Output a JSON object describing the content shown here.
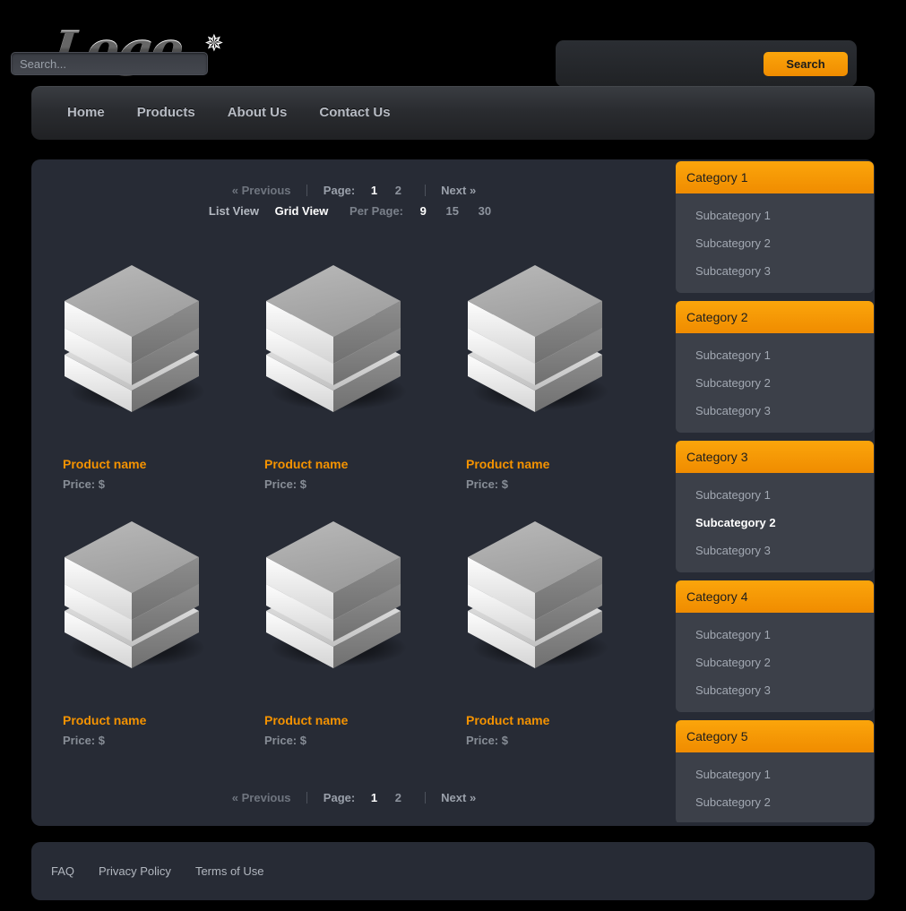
{
  "header": {
    "logo_text": "Logo",
    "logo_star_icon": "starburst-icon"
  },
  "search": {
    "placeholder": "Search...",
    "value": "",
    "button_label": "Search"
  },
  "nav": {
    "items": [
      {
        "label": "Home"
      },
      {
        "label": "Products"
      },
      {
        "label": "About Us"
      },
      {
        "label": "Contact Us"
      }
    ]
  },
  "pagination": {
    "previous_label": "« Previous",
    "page_label": "Page:",
    "pages": [
      {
        "label": "1",
        "active": true
      },
      {
        "label": "2",
        "active": false
      }
    ],
    "next_label": "Next »"
  },
  "view_options": {
    "list_view_label": "List View",
    "grid_view_label": "Grid View",
    "active_view": "Grid View",
    "per_page_label": "Per Page:",
    "per_page_options": [
      {
        "label": "9",
        "active": true
      },
      {
        "label": "15",
        "active": false
      },
      {
        "label": "30",
        "active": false
      }
    ]
  },
  "products": [
    {
      "name": "Product name",
      "price": "Price: $",
      "image_icon": "stacked-slabs-icon"
    },
    {
      "name": "Product name",
      "price": "Price: $",
      "image_icon": "stacked-slabs-icon"
    },
    {
      "name": "Product name",
      "price": "Price: $",
      "image_icon": "stacked-slabs-icon"
    },
    {
      "name": "Product name",
      "price": "Price: $",
      "image_icon": "stacked-slabs-icon"
    },
    {
      "name": "Product name",
      "price": "Price: $",
      "image_icon": "stacked-slabs-icon"
    },
    {
      "name": "Product name",
      "price": "Price: $",
      "image_icon": "stacked-slabs-icon"
    }
  ],
  "sidebar": {
    "categories": [
      {
        "title": "Category 1",
        "subcategories": [
          {
            "label": "Subcategory 1",
            "active": false
          },
          {
            "label": "Subcategory 2",
            "active": false
          },
          {
            "label": "Subcategory 3",
            "active": false
          }
        ]
      },
      {
        "title": "Category 2",
        "subcategories": [
          {
            "label": "Subcategory 1",
            "active": false
          },
          {
            "label": "Subcategory 2",
            "active": false
          },
          {
            "label": "Subcategory 3",
            "active": false
          }
        ]
      },
      {
        "title": "Category 3",
        "subcategories": [
          {
            "label": "Subcategory 1",
            "active": false
          },
          {
            "label": "Subcategory 2",
            "active": true
          },
          {
            "label": "Subcategory 3",
            "active": false
          }
        ]
      },
      {
        "title": "Category 4",
        "subcategories": [
          {
            "label": "Subcategory 1",
            "active": false
          },
          {
            "label": "Subcategory 2",
            "active": false
          },
          {
            "label": "Subcategory 3",
            "active": false
          }
        ]
      },
      {
        "title": "Category 5",
        "subcategories": [
          {
            "label": "Subcategory 1",
            "active": false
          },
          {
            "label": "Subcategory 2",
            "active": false
          }
        ]
      }
    ]
  },
  "footer": {
    "links": [
      {
        "label": "FAQ"
      },
      {
        "label": "Privacy Policy"
      },
      {
        "label": "Terms of Use"
      }
    ]
  },
  "colors": {
    "page_background": "#000000",
    "panel_background": "#272b35",
    "accent_orange": "#f08c00",
    "accent_orange_light": "#fba50b",
    "product_name": "#f59300",
    "subcategory_panel": "#3c4049",
    "nav_text": "#b8bcc4",
    "muted_text": "#878d96"
  }
}
